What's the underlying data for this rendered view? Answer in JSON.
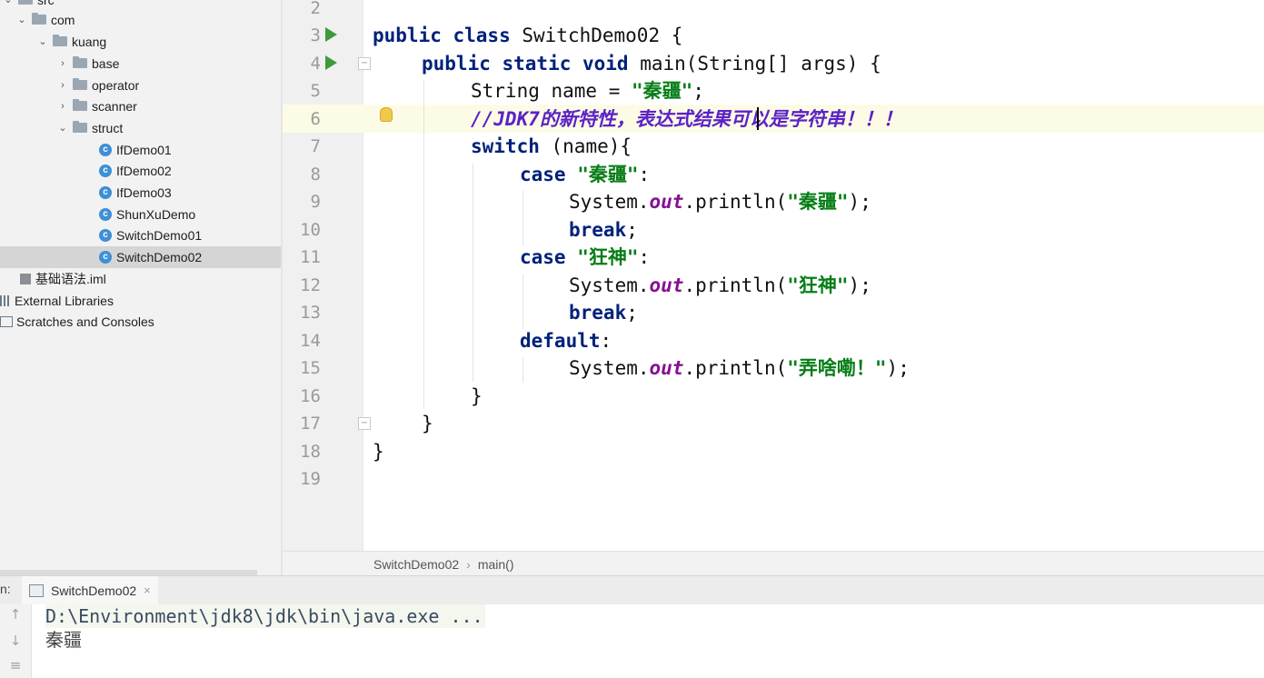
{
  "project_tree": {
    "items": [
      {
        "label": "src",
        "depth": 0,
        "kind": "folder",
        "arrow": "v"
      },
      {
        "label": "com",
        "depth": 1,
        "kind": "folder",
        "arrow": "v"
      },
      {
        "label": "kuang",
        "depth": 2,
        "kind": "folder",
        "arrow": "v"
      },
      {
        "label": "base",
        "depth": 3,
        "kind": "folder",
        "arrow": ">"
      },
      {
        "label": "operator",
        "depth": 3,
        "kind": "folder",
        "arrow": ">"
      },
      {
        "label": "scanner",
        "depth": 3,
        "kind": "folder",
        "arrow": ">"
      },
      {
        "label": "struct",
        "depth": 3,
        "kind": "folder",
        "arrow": "v"
      },
      {
        "label": "IfDemo01",
        "depth": 4,
        "kind": "class"
      },
      {
        "label": "IfDemo02",
        "depth": 4,
        "kind": "class"
      },
      {
        "label": "IfDemo03",
        "depth": 4,
        "kind": "class"
      },
      {
        "label": "ShunXuDemo",
        "depth": 4,
        "kind": "class"
      },
      {
        "label": "SwitchDemo01",
        "depth": 4,
        "kind": "class"
      },
      {
        "label": "SwitchDemo02",
        "depth": 4,
        "kind": "class",
        "selected": true
      },
      {
        "label": "基础语法.iml",
        "depth": 1,
        "kind": "iml"
      },
      {
        "label": "External Libraries",
        "depth": 0,
        "kind": "lib"
      },
      {
        "label": "Scratches and Consoles",
        "depth": 0,
        "kind": "scratch"
      }
    ]
  },
  "editor": {
    "line_numbers": [
      "2",
      "3",
      "4",
      "5",
      "6",
      "7",
      "8",
      "9",
      "10",
      "11",
      "12",
      "13",
      "14",
      "15",
      "16",
      "17",
      "18",
      "19"
    ],
    "code": {
      "l3_kw": "public class ",
      "l3_name": "SwitchDemo02 {",
      "l4_kw": "public static void ",
      "l4_rest": "main(String[] args) {",
      "l5_a": "String name = ",
      "l5_str": "\"秦疆\"",
      "l5_end": ";",
      "l6_comment": "//JDK7的新特性，表达式结果可以是字符串！！！",
      "l7_kw": "switch ",
      "l7_rest": "(name){",
      "l8_kw": "case ",
      "l8_str": "\"秦疆\"",
      "l8_end": ":",
      "l9_a": "System.",
      "l9_fld": "out",
      "l9_b": ".println(",
      "l9_str": "\"秦疆\"",
      "l9_end": ");",
      "l10_kw": "break",
      "l10_end": ";",
      "l11_kw": "case ",
      "l11_str": "\"狂神\"",
      "l11_end": ":",
      "l12_a": "System.",
      "l12_fld": "out",
      "l12_b": ".println(",
      "l12_str": "\"狂神\"",
      "l12_end": ");",
      "l13_kw": "break",
      "l13_end": ";",
      "l14_kw": "default",
      "l14_end": ":",
      "l15_a": "System.",
      "l15_fld": "out",
      "l15_b": ".println(",
      "l15_str": "\"弄啥嘞！\"",
      "l15_end": ");",
      "l16": "}",
      "l17": "}",
      "l18": "}"
    }
  },
  "breadcrumb": {
    "class_name": "SwitchDemo02",
    "method": "main()"
  },
  "run_panel": {
    "label": "n:",
    "tab_label": "SwitchDemo02",
    "close_glyph": "×",
    "command_line": "D:\\Environment\\jdk8\\jdk\\bin\\java.exe ...",
    "output": "秦疆",
    "tool_icons": [
      "up-arrow-icon",
      "down-arrow-icon",
      "soft-wrap-icon"
    ]
  }
}
